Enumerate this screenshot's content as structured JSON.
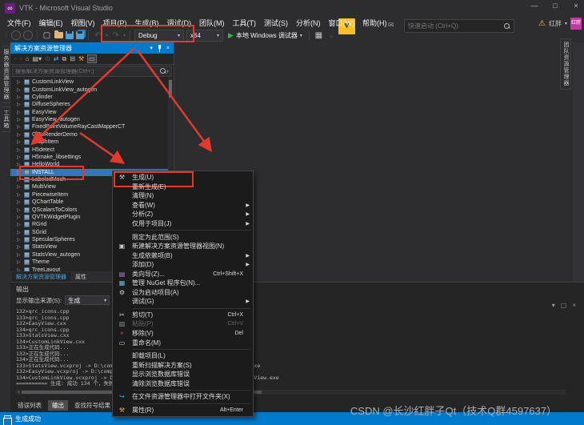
{
  "window": {
    "title": "VTK - Microsoft Visual Studio",
    "quick_launch_placeholder": "快速启动 (Ctrl+Q)",
    "minimize": "—",
    "maximize": "□",
    "close": "×",
    "user_name": "红胖",
    "avatar_text": "红胖",
    "logo_glyph": "∞"
  },
  "menu_bar": {
    "items": [
      "文件(F)",
      "编辑(E)",
      "视图(V)",
      "项目(P)",
      "生成(B)",
      "调试(D)",
      "团队(M)",
      "工具(T)",
      "测试(S)",
      "分析(N)",
      "窗口(W)",
      "帮助(H)"
    ]
  },
  "toolbar": {
    "config_label": "Debug",
    "platform_label": "x64",
    "run_label": "本地 Windows 调试器"
  },
  "left_tabs": [
    "服务器资源管理器",
    "工具箱"
  ],
  "right_tabs": [
    "团队资源管理器"
  ],
  "solution_explorer": {
    "title": "解决方案资源管理器",
    "search_placeholder": "搜索解决方案资源管理器(Ctrl+;)",
    "selected_index": 12,
    "items": [
      "CustomLinkView",
      "CustomLinkView_autogen",
      "Cylinder",
      "DiffuseSpheres",
      "EasyView",
      "EasyView_autogen",
      "FixedPointVolumeRayCastMapperCT",
      "GPURenderDemo",
      "GraphItem",
      "H5detect",
      "H5make_libsettings",
      "HelloWorld",
      "INSTALL",
      "LabeledMesh",
      "MultiView",
      "PiecewiseItem",
      "QChartTable",
      "QScalarsToColors",
      "QVTKWidgetPlugin",
      "RGrid",
      "SGrid",
      "SpecularSpheres",
      "StatsView",
      "StatsView_autogen",
      "Theme",
      "TreeLayout"
    ],
    "bottom_tabs": [
      "解决方案资源管理器",
      "属性"
    ],
    "active_bottom_tab": "解决方案资源管理器"
  },
  "context_menu": {
    "items": [
      {
        "label": "生成(U)",
        "icon": "build-icon",
        "boxed": true
      },
      {
        "label": "重新生成(E)"
      },
      {
        "label": "清理(N)"
      },
      {
        "label": "查看(W)",
        "submenu": true
      },
      {
        "label": "分析(Z)",
        "submenu": true
      },
      {
        "label": "仅用于项目(J)",
        "submenu": true
      },
      {
        "separator": true
      },
      {
        "label": "限定为此范围(S)"
      },
      {
        "label": "新建解决方案资源管理器视图(N)",
        "icon": "new-view-icon"
      },
      {
        "label": "生成依赖项(B)",
        "submenu": true
      },
      {
        "label": "添加(D)",
        "submenu": true
      },
      {
        "label": "类向导(Z)...",
        "shortcut": "Ctrl+Shift+X",
        "icon": "class-wizard-icon"
      },
      {
        "label": "管理 NuGet 程序包(N)...",
        "icon": "nuget-icon"
      },
      {
        "label": "设为启动项目(A)",
        "icon": "startup-icon"
      },
      {
        "label": "调试(G)",
        "submenu": true
      },
      {
        "separator": true
      },
      {
        "label": "剪切(T)",
        "shortcut": "Ctrl+X",
        "icon": "cut-icon"
      },
      {
        "label": "粘贴(P)",
        "shortcut": "Ctrl+V",
        "icon": "paste-icon",
        "disabled": true
      },
      {
        "label": "移除(V)",
        "shortcut": "Del",
        "icon": "remove-icon"
      },
      {
        "label": "重命名(M)",
        "icon": "rename-icon"
      },
      {
        "separator": true
      },
      {
        "label": "卸载项目(L)"
      },
      {
        "label": "重新扫描解决方案(S)"
      },
      {
        "label": "显示浏览数据库错误"
      },
      {
        "label": "清除浏览数据库错误"
      },
      {
        "separator": true
      },
      {
        "label": "在文件资源管理器中打开文件夹(X)",
        "icon": "open-folder-icon"
      },
      {
        "separator": true
      },
      {
        "label": "属性(R)",
        "shortcut": "Alt+Enter",
        "icon": "properties-icon"
      }
    ]
  },
  "output": {
    "title": "输出",
    "source_label": "显示输出来源(S):",
    "source_value": "生成",
    "lines": [
      "132>qrc_icons.cpp",
      "133>qrc_icons.cpp",
      "132>EasyView.cxx",
      "134>qrc_icons.cpp",
      "133>StatsView.cxx",
      "134>CustomLinkView.cxx",
      "133>正在生成代码...",
      "132>正在生成代码...",
      "134>正在生成代码...",
      "133>StatsView.vcxproj -> D:\\compile\\vtkProject\\vtkDemo\\x64\\Debug\\StatsView.exe",
      "132>EasyView.vcxproj -> D:\\compile\\vtkProject\\vtkDemo\\x64\\Debug\\EasyView.exe",
      "134>CustomLinkView.vcxproj -> D:\\compile\\vtkProject\\vtkDemo\\Debug\\CustomLinkView.exe",
      "========== 生成: 成功 134 个，失败 0 个，最新 0 个，跳过 0 个 =========="
    ],
    "bottom_tabs": [
      "错误列表",
      "输出",
      "查找符号结果"
    ],
    "active_tab": "输出"
  },
  "status_bar": {
    "text": "生成成功"
  },
  "watermark": "CSDN @长沙红胖子Qt（技术Q群4597637）",
  "colors": {
    "accent": "#007ACC",
    "annotation_red": "#E23A2E",
    "selection_blue": "#3575BD",
    "warning_yellow": "#F6C026",
    "avatar_pink": "#C4399F"
  }
}
